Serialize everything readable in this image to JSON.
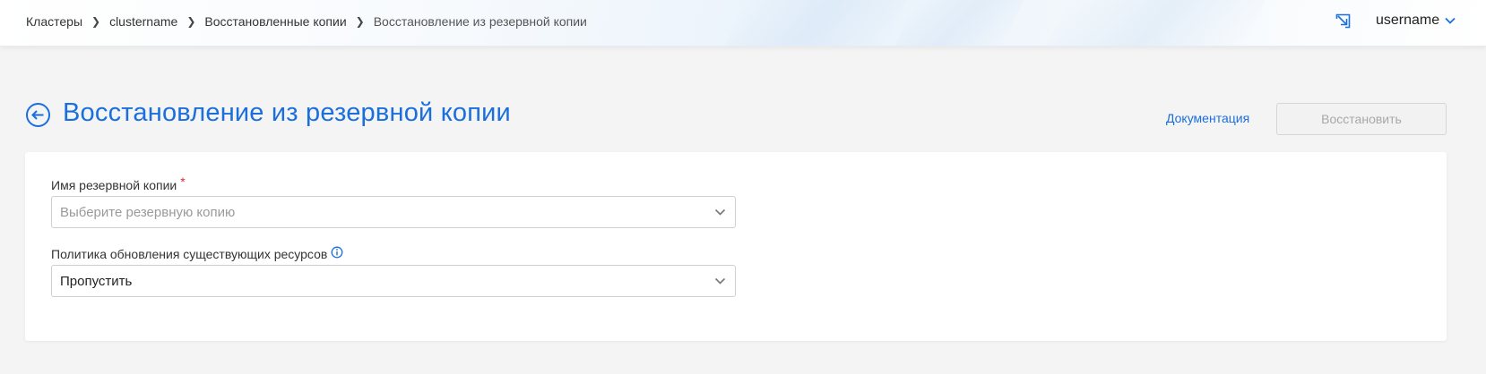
{
  "breadcrumb": {
    "items": [
      "Кластеры",
      "clustername",
      "Восстановленные копии"
    ],
    "current": "Восстановление из резервной копии"
  },
  "header": {
    "username": "username",
    "icons": [
      "export-icon",
      "chevron-down-icon"
    ]
  },
  "page": {
    "title": "Восстановление из резервной копии",
    "documentation_link": "Документация",
    "restore_button": "Восстановить"
  },
  "form": {
    "backup_name": {
      "label": "Имя резервной копии",
      "required_mark": "*",
      "placeholder": "Выберите резервную копию",
      "value": ""
    },
    "update_policy": {
      "label": "Политика обновления существующих ресурсов",
      "value": "Пропустить",
      "icon": "info-icon"
    }
  },
  "colors": {
    "accent": "#1a6fdc",
    "required": "#e0292e",
    "background": "#f4f4f4",
    "disabled_text": "#a8a8a8"
  }
}
